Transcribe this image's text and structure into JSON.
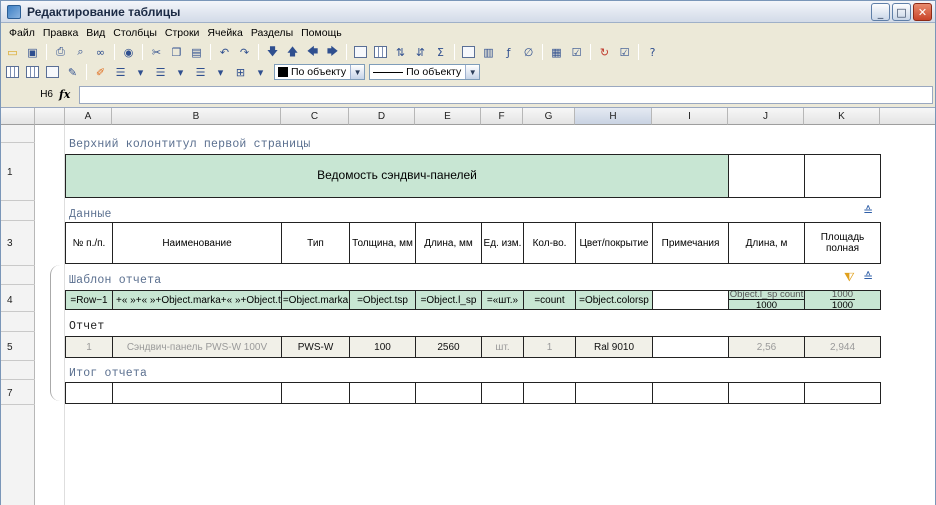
{
  "window": {
    "title": "Редактирование таблицы"
  },
  "menu": [
    "Файл",
    "Правка",
    "Вид",
    "Столбцы",
    "Строки",
    "Ячейка",
    "Разделы",
    "Помощь"
  ],
  "toolbar": {
    "fill_combo": "По объекту",
    "line_combo": "По объекту"
  },
  "formula_bar": {
    "cell_ref": "H6",
    "fx": "fx",
    "value": ""
  },
  "columns": [
    "A",
    "B",
    "C",
    "D",
    "E",
    "F",
    "G",
    "H",
    "I",
    "J",
    "K"
  ],
  "active_column": "H",
  "row_numbers": [
    "1",
    "3",
    "4",
    "5",
    "7"
  ],
  "sections": {
    "header": "Верхний колонтитул первой страницы",
    "data": "Данные",
    "template": "Шаблон отчета",
    "report": "Отчет",
    "total": "Итог отчета"
  },
  "title_cell": "Ведомость сэндвич-панелей",
  "data_headers": [
    "№ п./п.",
    "Наименование",
    "Тип",
    "Толщина, мм",
    "Длина, мм",
    "Ед. изм.",
    "Кол-во.",
    "Цвет/покрытие",
    "Примечания",
    "Длина, м",
    "Площадь полная"
  ],
  "template_row": [
    "=Row−1",
    "+« »+« »+Object.marka+« »+Object.tsp",
    "=Object.marka",
    "=Object.tsp",
    "=Object.l_sp",
    "=«шт.»",
    "=count",
    "=Object.colorsp",
    ""
  ],
  "template_fracs": {
    "j": {
      "num": "Object.l_sp",
      "num_suffix": "count",
      "den": "1000"
    },
    "k": {
      "num": "1000",
      "den": "1000"
    }
  },
  "report_row": [
    "1",
    "Сэндвич-панель PWS-W 100V",
    "PWS-W",
    "100",
    "2560",
    "шт.",
    "1",
    "Ral 9010",
    "",
    "2,56",
    "2,944"
  ]
}
